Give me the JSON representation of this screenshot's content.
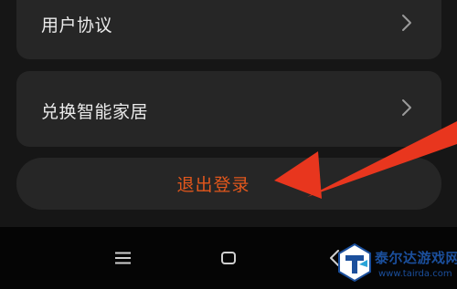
{
  "settings": {
    "items": [
      {
        "label": "用户协议"
      },
      {
        "label": "兑换智能家居"
      }
    ],
    "logout_label": "退出登录"
  },
  "navbar": {
    "icons": [
      "menu-icon",
      "home-icon",
      "back-icon"
    ]
  },
  "annotation": {
    "arrow_color": "#e8361e"
  },
  "watermark": {
    "title": "泰尔达游戏网",
    "url": "www.tairda.com"
  },
  "colors": {
    "background": "#161616",
    "card": "#262626",
    "text": "#eaeaea",
    "logout_text": "#e2571c",
    "navbar": "#050505"
  }
}
